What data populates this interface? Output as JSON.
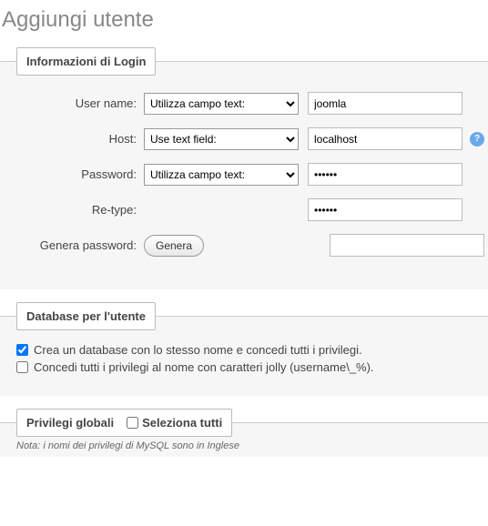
{
  "title": "Aggiungi utente",
  "loginInfo": {
    "legend": "Informazioni di Login",
    "userNameLabel": "User name:",
    "userNameSelect": "Utilizza campo text:",
    "userNameValue": "joomla",
    "hostLabel": "Host:",
    "hostSelect": "Use text field:",
    "hostValue": "localhost",
    "passwordLabel": "Password:",
    "passwordSelect": "Utilizza campo text:",
    "passwordValue": "••••••",
    "retypeLabel": "Re-type:",
    "retypeValue": "••••••",
    "generateLabel": "Genera password:",
    "generateButton": "Genera",
    "generatedValue": ""
  },
  "dbUser": {
    "legend": "Database per l'utente",
    "createDb": "Crea un database con lo stesso nome e concedi tutti i privilegi.",
    "grantWildcard": "Concedi tutti i privilegi al nome con caratteri jolly (username\\_%)."
  },
  "globalPriv": {
    "legend": "Privilegi globali",
    "selectAll": "Seleziona tutti",
    "note": "Nota: i nomi dei privilegi di MySQL sono in Inglese"
  }
}
